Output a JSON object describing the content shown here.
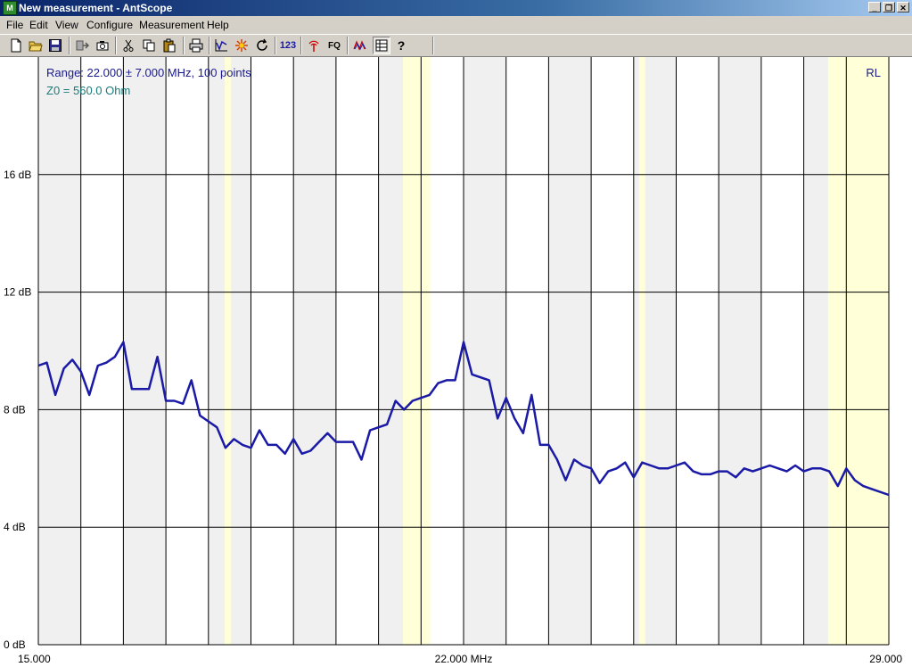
{
  "window": {
    "title": "New measurement - AntScope",
    "app_icon_glyph": "M",
    "minimize_glyph": "_",
    "restore_glyph": "❐",
    "close_glyph": "✕"
  },
  "menu": [
    "File",
    "Edit",
    "View",
    "Configure",
    "Measurement",
    "Help"
  ],
  "toolbar": {
    "buttons": [
      {
        "name": "new-file-icon"
      },
      {
        "name": "open-folder-icon"
      },
      {
        "name": "save-icon"
      },
      {
        "name": "export-icon"
      },
      {
        "name": "camera-icon"
      },
      {
        "name": "cut-icon"
      },
      {
        "name": "copy-icon"
      },
      {
        "name": "paste-icon"
      },
      {
        "name": "print-icon"
      },
      {
        "name": "chart-icon"
      },
      {
        "name": "sparkle-icon"
      },
      {
        "name": "refresh-icon"
      },
      {
        "name": "numeric-icon",
        "label": "123"
      },
      {
        "name": "antenna-icon"
      },
      {
        "name": "frequency-icon",
        "label": "FQ"
      },
      {
        "name": "band-icon"
      },
      {
        "name": "table-icon"
      },
      {
        "name": "help-icon",
        "label": "?"
      }
    ]
  },
  "colors": {
    "trace": "#1a1aa6",
    "band_band": "#ffffd8",
    "band_stripe": "#f0f0f0",
    "gridline": "#000000"
  },
  "chart_data": {
    "type": "line",
    "range_text": "Range: 22.000 ± 7.000 MHz, 100 points",
    "z0_text": "Z0 = 560.0 Ohm",
    "trace_label": "RL",
    "xlim": [
      15.0,
      29.0
    ],
    "ylim": [
      0,
      20
    ],
    "y_ticks": [
      {
        "value": 0,
        "label": "0 dB"
      },
      {
        "value": 4,
        "label": "4 dB"
      },
      {
        "value": 8,
        "label": "8 dB"
      },
      {
        "value": 12,
        "label": "12 dB"
      },
      {
        "value": 16,
        "label": "16 dB"
      }
    ],
    "x_ticks": [
      {
        "value": 15.0,
        "label": "15.000"
      },
      {
        "value": 22.0,
        "label": "22.000 MHz"
      },
      {
        "value": 29.0,
        "label": "29.000"
      }
    ],
    "ham_bands_mhz": [
      [
        18.068,
        18.168
      ],
      [
        21.0,
        21.45
      ],
      [
        24.89,
        24.99
      ],
      [
        28.0,
        29.7
      ]
    ],
    "series": [
      {
        "x": [
          15.0,
          15.14,
          15.28,
          15.42,
          15.56,
          15.7,
          15.84,
          15.98,
          16.12,
          16.26,
          16.4,
          16.54,
          16.68,
          16.82,
          16.96,
          17.1,
          17.24,
          17.38,
          17.52,
          17.66,
          17.8,
          17.94,
          18.08,
          18.22,
          18.36,
          18.5,
          18.64,
          18.78,
          18.92,
          19.06,
          19.2,
          19.34,
          19.48,
          19.62,
          19.76,
          19.9,
          20.04,
          20.18,
          20.32,
          20.46,
          20.6,
          20.74,
          20.88,
          21.02,
          21.16,
          21.3,
          21.44,
          21.58,
          21.72,
          21.86,
          22.0,
          22.14,
          22.28,
          22.42,
          22.56,
          22.7,
          22.84,
          22.98,
          23.12,
          23.26,
          23.4,
          23.54,
          23.68,
          23.82,
          23.96,
          24.1,
          24.24,
          24.38,
          24.52,
          24.66,
          24.8,
          24.94,
          25.08,
          25.22,
          25.36,
          25.5,
          25.64,
          25.78,
          25.92,
          26.06,
          26.2,
          26.34,
          26.48,
          26.62,
          26.76,
          26.9,
          27.04,
          27.18,
          27.32,
          27.46,
          27.6,
          27.74,
          27.88,
          28.02,
          28.16,
          28.3,
          28.44,
          28.58,
          28.72,
          29.0
        ],
        "y": [
          9.5,
          9.6,
          8.5,
          9.4,
          9.7,
          9.3,
          8.5,
          9.5,
          9.6,
          9.8,
          10.3,
          8.7,
          8.7,
          8.7,
          9.8,
          8.3,
          8.3,
          8.2,
          9.0,
          7.8,
          7.6,
          7.4,
          6.7,
          7.0,
          6.8,
          6.7,
          7.3,
          6.8,
          6.8,
          6.5,
          7.0,
          6.5,
          6.6,
          6.9,
          7.2,
          6.9,
          6.9,
          6.9,
          6.3,
          7.3,
          7.4,
          7.5,
          8.3,
          8.0,
          8.3,
          8.4,
          8.5,
          8.9,
          9.0,
          9.0,
          10.3,
          9.2,
          9.1,
          9.0,
          7.7,
          8.4,
          7.7,
          7.2,
          8.5,
          6.8,
          6.8,
          6.3,
          5.6,
          6.3,
          6.1,
          6.0,
          5.5,
          5.9,
          6.0,
          6.2,
          5.7,
          6.2,
          6.1,
          6.0,
          6.0,
          6.1,
          6.2,
          5.9,
          5.8,
          5.8,
          5.9,
          5.9,
          5.7,
          6.0,
          5.9,
          6.0,
          6.1,
          6.0,
          5.9,
          6.1,
          5.9,
          6.0,
          6.0,
          5.9,
          5.4,
          6.0,
          5.6,
          5.4,
          5.3,
          5.1
        ]
      }
    ]
  }
}
